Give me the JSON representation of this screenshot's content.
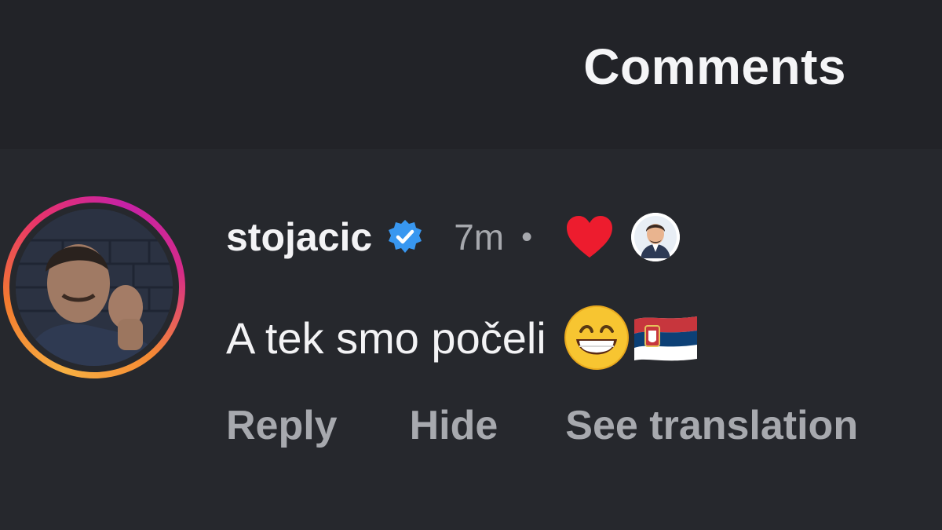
{
  "header": {
    "title": "Comments"
  },
  "comment": {
    "username": "stojacic",
    "verified_icon": "verified-badge-icon",
    "time": "7m",
    "separator": "•",
    "liked_by_icon": "heart-icon",
    "text": "A tek smo počeli",
    "emojis": [
      "grinning-face-icon",
      "serbia-flag-icon"
    ],
    "actions": {
      "reply": "Reply",
      "hide": "Hide",
      "see_translation": "See translation"
    }
  },
  "colors": {
    "background": "#26282d",
    "header_background": "#222328",
    "primary_text": "#f3f3f5",
    "secondary_text": "#a6a8ad",
    "verified_blue": "#3897f0",
    "heart_red": "#ed1c2e"
  }
}
